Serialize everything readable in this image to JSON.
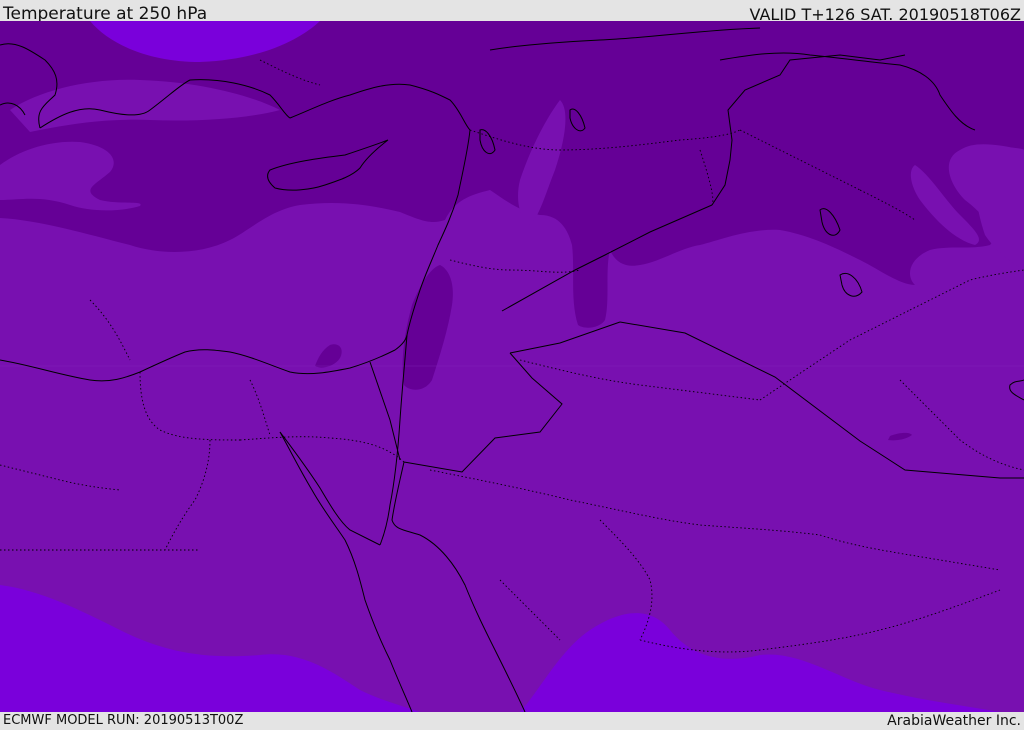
{
  "header": {
    "title": "Temperature at 250 hPa",
    "valid": "VALID T+126 SAT. 20190518T06Z"
  },
  "footer": {
    "model_run": "ECMWF MODEL RUN: 20190513T00Z",
    "credit": "ArabiaWeather Inc."
  },
  "colors": {
    "cold_band": "#650096",
    "base_field": "#7810b0",
    "warm_band": "#7a00db",
    "borders": "#000000",
    "background": "#e4e4e4"
  }
}
